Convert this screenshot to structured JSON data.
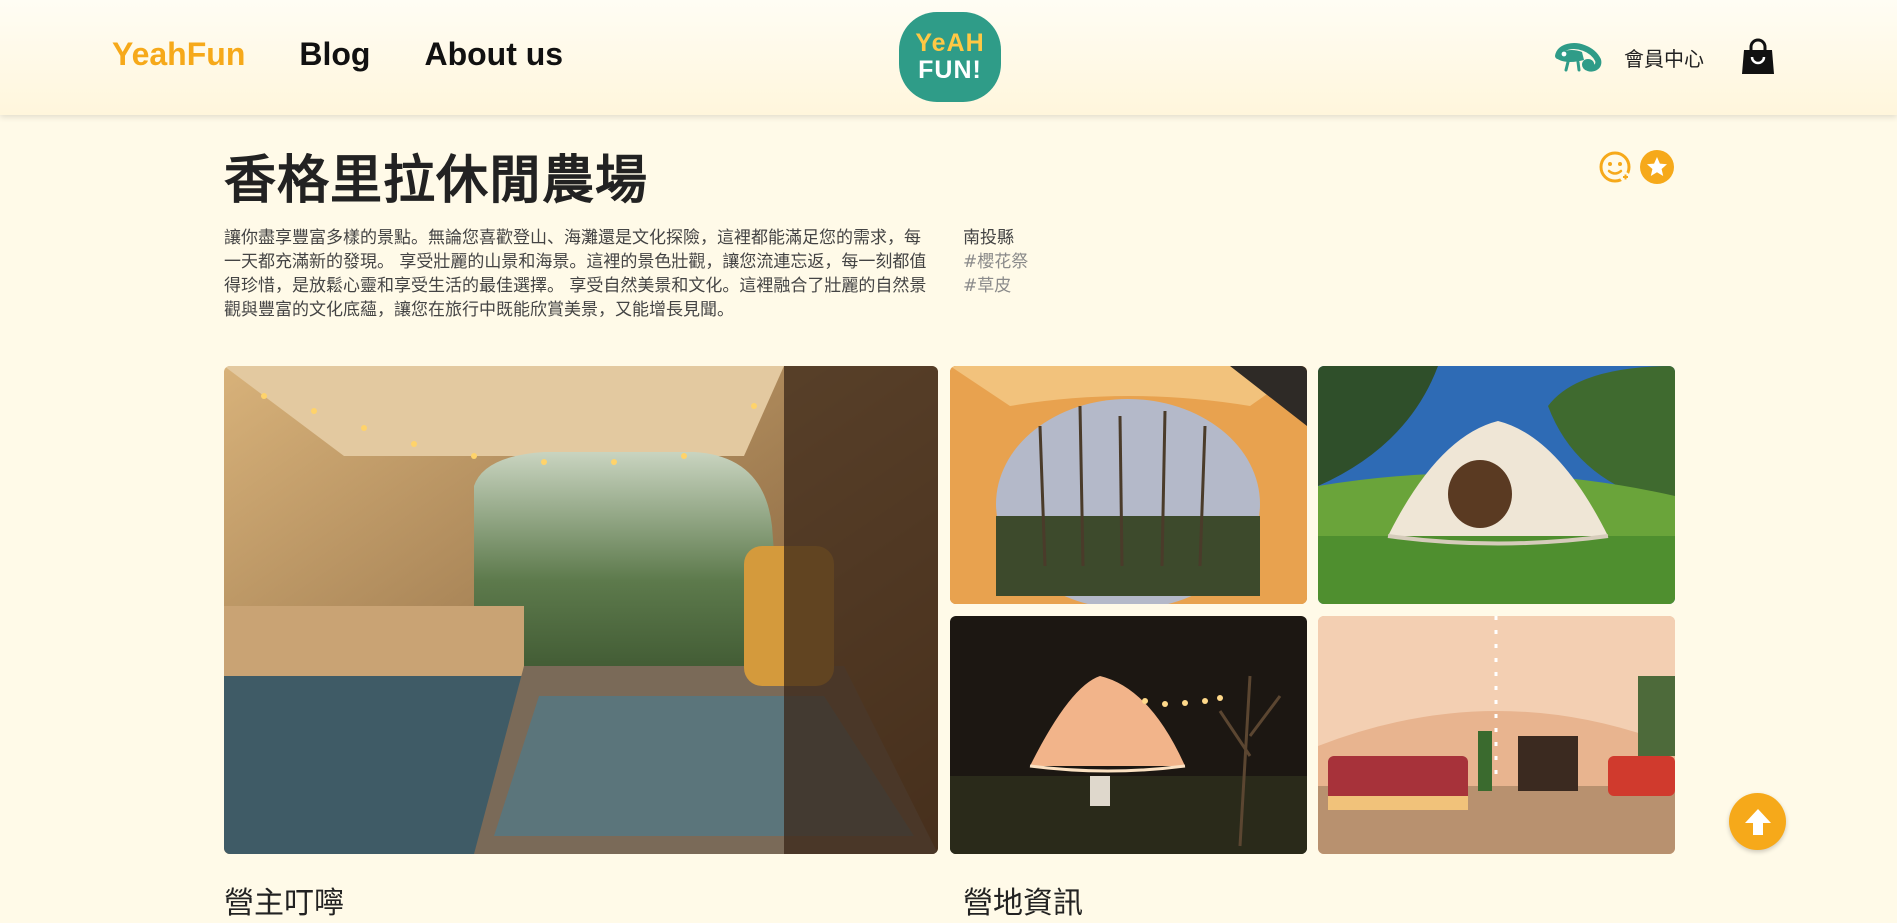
{
  "nav": {
    "brand": "YeahFun",
    "blog": "Blog",
    "about": "About us"
  },
  "logo": {
    "line1": "YeAH",
    "line2": "FUN!"
  },
  "header": {
    "member_label": "會員中心"
  },
  "page": {
    "title": "香格里拉休閒農場",
    "description": "讓你盡享豐富多樣的景點。無論您喜歡登山、海灘還是文化探險，這裡都能滿足您的需求，每一天都充滿新的發現。 享受壯麗的山景和海景。這裡的景色壯觀，讓您流連忘返，每一刻都值得珍惜，是放鬆心靈和享受生活的最佳選擇。 享受自然美景和文化。這裡融合了壯麗的自然景觀與豐富的文化底蘊，讓您在旅行中既能欣賞美景，又能增長見聞。",
    "region": "南投縣",
    "tags": [
      "#櫻花祭",
      "#草皮"
    ]
  },
  "sections": {
    "host_notes": "營主叮嚀",
    "camp_info": "營地資訊"
  },
  "colors": {
    "accent": "#f6a91a",
    "teal": "#2f9c88",
    "background": "#fffae8"
  },
  "icons": [
    "smiley-face-icon",
    "star-icon",
    "chameleon-icon",
    "shopping-bag-icon",
    "arrow-up-icon"
  ]
}
